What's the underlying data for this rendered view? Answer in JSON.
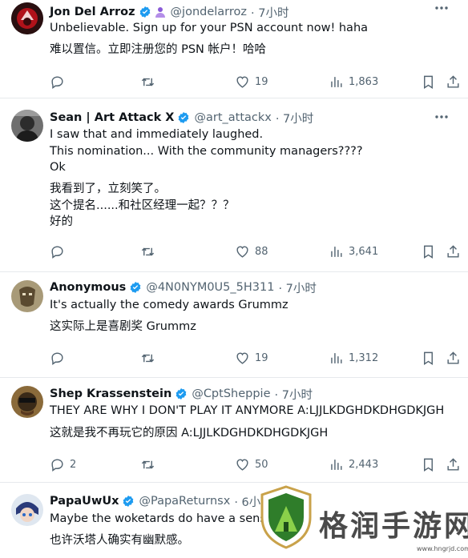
{
  "tweets": [
    {
      "name": "Jon Del Arroz",
      "handle": "@jondelarroz",
      "time": "· 7小时",
      "lines": [
        "Unbelievable.  Sign up for your PSN account now! haha",
        "难以置信。立即注册您的 PSN 帐户！哈哈"
      ],
      "replies": "",
      "retweets": "",
      "likes": "19",
      "views": "1,863"
    },
    {
      "name": "Sean | Art Attack X",
      "handle": "@art_attackx",
      "time": "· 7小时",
      "lines": [
        "I saw that and immediately laughed.",
        "This nomination... With the community managers????",
        "Ok",
        "我看到了，立刻笑了。",
        "这个提名......和社区经理一起？？？",
        "好的"
      ],
      "replies": "",
      "retweets": "",
      "likes": "88",
      "views": "3,641"
    },
    {
      "name": "Anonymous",
      "handle": "@4N0NYM0U5_5H311",
      "time": "· 7小时",
      "lines": [
        "It's actually the comedy awards Grummz",
        "这实际上是喜剧奖 Grummz"
      ],
      "replies": "",
      "retweets": "",
      "likes": "19",
      "views": "1,312"
    },
    {
      "name": "Shep Krassenstein",
      "handle": "@CptSheppie",
      "time": "· 7小时",
      "lines": [
        "THEY ARE WHY I DON'T PLAY IT ANYMORE A:LJJLKDGHDKDHGDKJGH",
        "这就是我不再玩它的原因 A:LJJLKDGHDKDHGDKJGH"
      ],
      "replies": "2",
      "retweets": "",
      "likes": "50",
      "views": "2,443"
    },
    {
      "name": "PapaUwUx",
      "handle": "@PapaReturnsx",
      "time": "· 6小时",
      "lines": [
        "Maybe the woketards do have a sense",
        "也许沃塔人确实有幽默感。"
      ]
    }
  ],
  "colors": {
    "verified": "#1d9bf0",
    "text": "#0f1419",
    "secondary": "#536471",
    "affiliate": "#8a5ad8"
  },
  "icons": [
    "reply-icon",
    "retweet-icon",
    "like-icon",
    "views-icon",
    "bookmark-icon",
    "share-icon",
    "more-icon",
    "verified-icon"
  ],
  "watermark": {
    "text": "格润手游网",
    "url": "www.hngrjd.com"
  }
}
